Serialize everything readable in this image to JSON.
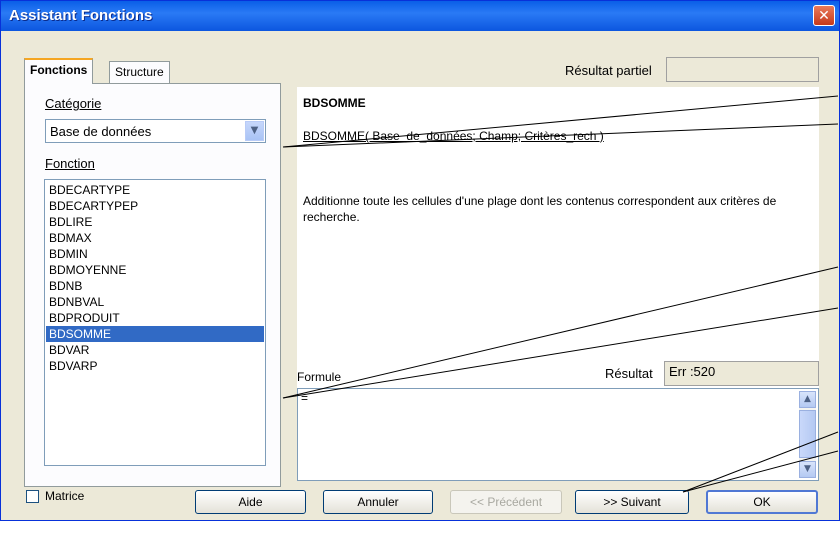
{
  "window": {
    "title": "Assistant Fonctions",
    "close_glyph": "✕"
  },
  "tabs": [
    {
      "label": "Fonctions",
      "active": true
    },
    {
      "label": "Structure",
      "active": false
    }
  ],
  "category": {
    "label": "Catégorie",
    "selected": "Base de données"
  },
  "function_list": {
    "label": "Fonction",
    "items": [
      "BDECARTYPE",
      "BDECARTYPEP",
      "BDLIRE",
      "BDMAX",
      "BDMIN",
      "BDMOYENNE",
      "BDNB",
      "BDNBVAL",
      "BDPRODUIT",
      "BDSOMME",
      "BDVAR",
      "BDVARP"
    ],
    "selected": "BDSOMME"
  },
  "partial_result": {
    "label": "Résultat partiel",
    "value": ""
  },
  "function_info": {
    "name": "BDSOMME",
    "syntax": "BDSOMME( Base_de_données; Champ; Critères_rech )",
    "description": "Additionne toute les cellules d'une plage dont les contenus correspondent aux critères de recherche."
  },
  "formula": {
    "label": "Formule",
    "value": "=",
    "result_label": "Résultat",
    "result_value": "Err :520"
  },
  "matrix": {
    "label": "Matrice",
    "checked": false
  },
  "buttons": {
    "help": "Aide",
    "cancel": "Annuler",
    "previous": "<< Précédent",
    "next": ">> Suivant",
    "ok": "OK"
  },
  "colors": {
    "titlebar": "#0a5fe7",
    "dialog_bg": "#ece9d8",
    "selection": "#316ac5"
  }
}
